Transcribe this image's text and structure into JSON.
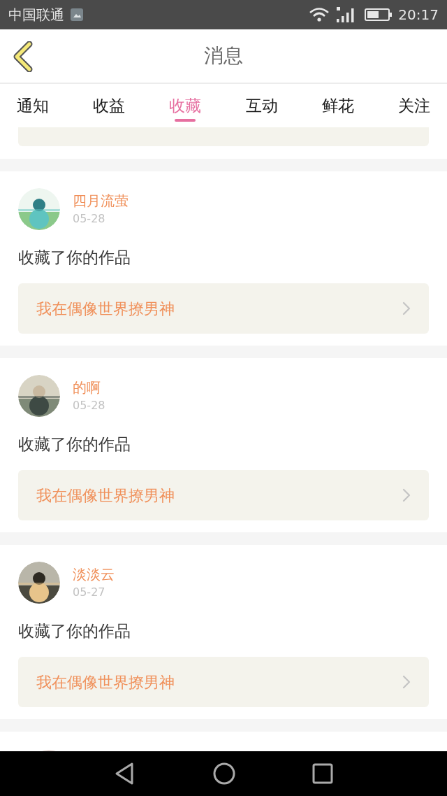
{
  "status_bar": {
    "carrier": "中国联通",
    "time": "20:17"
  },
  "header": {
    "title": "消息"
  },
  "tabs": [
    {
      "label": "通知",
      "selected": false
    },
    {
      "label": "收益",
      "selected": false
    },
    {
      "label": "收藏",
      "selected": true
    },
    {
      "label": "互动",
      "selected": false
    },
    {
      "label": "鲜花",
      "selected": false
    },
    {
      "label": "关注",
      "selected": false
    }
  ],
  "messages": [
    {
      "name": "四月流萤",
      "date": "05-28",
      "action": "收藏了你的作品",
      "work_title": "我在偶像世界撩男神"
    },
    {
      "name": "的啊",
      "date": "05-28",
      "action": "收藏了你的作品",
      "work_title": "我在偶像世界撩男神"
    },
    {
      "name": "淡淡云",
      "date": "05-27",
      "action": "收藏了你的作品",
      "work_title": "我在偶像世界撩男神"
    }
  ]
}
